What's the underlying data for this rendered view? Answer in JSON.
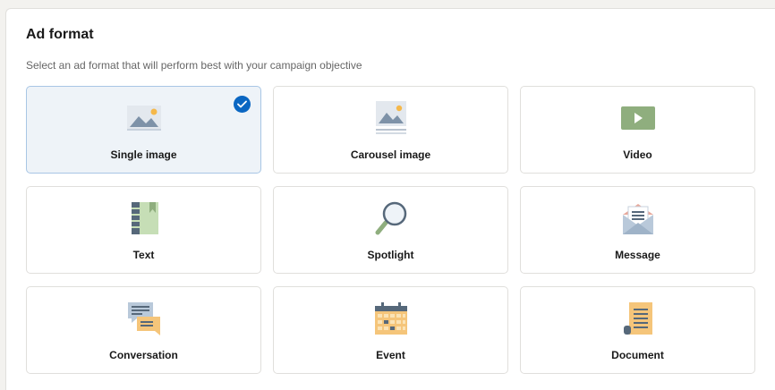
{
  "section": {
    "title": "Ad format",
    "subtitle": "Select an ad format that will perform best with your campaign objective"
  },
  "formats": [
    {
      "label": "Single image",
      "icon": "image-icon",
      "selected": true
    },
    {
      "label": "Carousel image",
      "icon": "carousel-icon",
      "selected": false
    },
    {
      "label": "Video",
      "icon": "video-icon",
      "selected": false
    },
    {
      "label": "Text",
      "icon": "text-ad-icon",
      "selected": false
    },
    {
      "label": "Spotlight",
      "icon": "magnifier-icon",
      "selected": false
    },
    {
      "label": "Message",
      "icon": "envelope-icon",
      "selected": false
    },
    {
      "label": "Conversation",
      "icon": "chat-bubbles-icon",
      "selected": false
    },
    {
      "label": "Event",
      "icon": "calendar-icon",
      "selected": false
    },
    {
      "label": "Document",
      "icon": "document-icon",
      "selected": false
    }
  ],
  "colors": {
    "accent": "#0a66c2",
    "selected_bg": "#eef3f8",
    "selected_border": "#a8c6e5"
  }
}
